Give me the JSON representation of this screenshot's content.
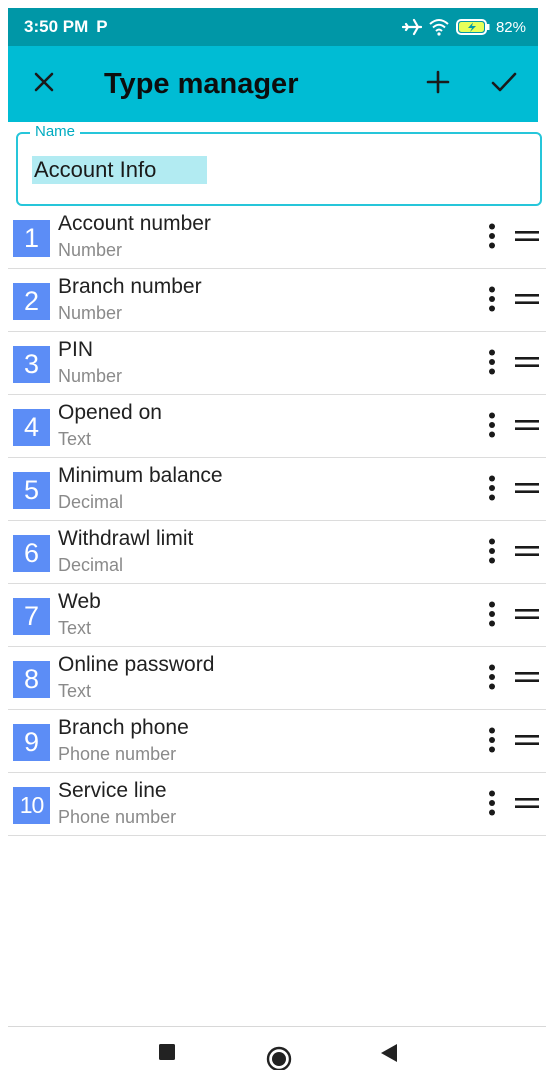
{
  "status_bar": {
    "time": "3:50 PM",
    "app_indicator": "P",
    "battery": "82%",
    "icons": [
      "airplane-icon",
      "wifi-icon",
      "battery-charging-icon"
    ]
  },
  "app_bar": {
    "title": "Type manager",
    "background": "#00bcd4",
    "icons": [
      "close-icon",
      "add-icon",
      "check-icon"
    ]
  },
  "name_field": {
    "label": "Name",
    "value": "Account Info"
  },
  "fields": [
    {
      "index": "1",
      "name": "Account number",
      "type": "Number"
    },
    {
      "index": "2",
      "name": "Branch number",
      "type": "Number"
    },
    {
      "index": "3",
      "name": "PIN",
      "type": "Number"
    },
    {
      "index": "4",
      "name": "Opened on",
      "type": "Text"
    },
    {
      "index": "5",
      "name": "Minimum balance",
      "type": "Decimal"
    },
    {
      "index": "6",
      "name": "Withdrawl limit",
      "type": "Decimal"
    },
    {
      "index": "7",
      "name": "Web",
      "type": "Text"
    },
    {
      "index": "8",
      "name": "Online password",
      "type": "Text"
    },
    {
      "index": "9",
      "name": "Branch phone",
      "type": "Phone number"
    },
    {
      "index": "10",
      "name": "Service line",
      "type": "Phone number"
    }
  ],
  "row_icons": [
    "more-vert-icon",
    "drag-handle-icon"
  ],
  "nav_bar": {
    "icons": [
      "recent-apps-icon",
      "home-icon",
      "back-icon"
    ]
  },
  "colors": {
    "accent": "#00bcd4",
    "status_bar": "#0097a7",
    "badge": "#5c8df6",
    "field_border": "#26c6da"
  }
}
